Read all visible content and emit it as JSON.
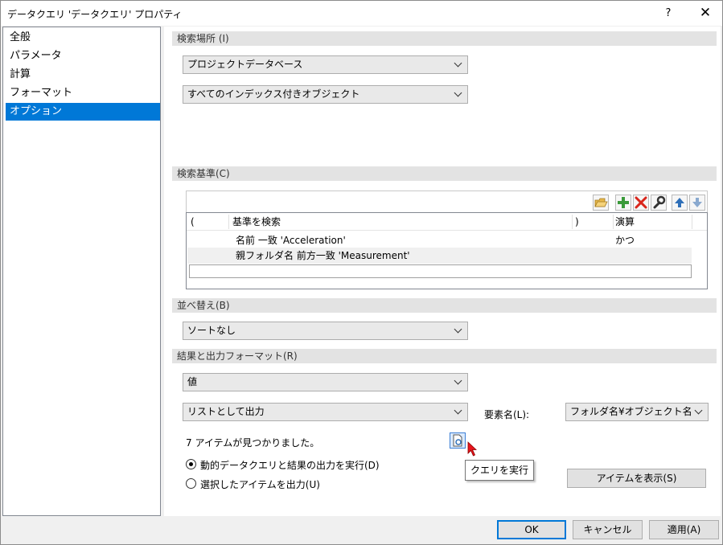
{
  "window": {
    "title": "データクエリ 'データクエリ' プロパティ",
    "help": "?",
    "close": "✕"
  },
  "nav": {
    "items": [
      "全般",
      "パラメータ",
      "計算",
      "フォーマット",
      "オプション"
    ],
    "selected_index": 4
  },
  "search_location": {
    "header": "検索場所 (I)",
    "database": "プロジェクトデータベース",
    "objects": "すべてのインデックス付きオブジェクト"
  },
  "search_criteria": {
    "header": "検索基準(C)",
    "columns": [
      "(",
      "基準を検索",
      ")",
      "演算"
    ],
    "rows": [
      {
        "open": "",
        "criterion": "名前 一致 'Acceleration'",
        "close": "",
        "operator": "かつ"
      },
      {
        "open": "",
        "criterion": "親フォルダ名 前方一致 'Measurement'",
        "close": "",
        "operator": ""
      }
    ],
    "toolbar_icons": [
      "open-folder-icon",
      "add-icon",
      "delete-icon",
      "wrench-icon",
      "arrow-up-icon",
      "arrow-down-icon"
    ]
  },
  "sort": {
    "header": "並べ替え(B)",
    "value": "ソートなし"
  },
  "results": {
    "header": "結果と出力フォーマット(R)",
    "value_format": "値",
    "output_mode": "リストとして出力",
    "element_name_label": "要素名(L):",
    "element_name_value": "フォルダ名¥オブジェクト名",
    "found_text": "7 アイテムが見つかりました。",
    "query_tooltip": "クエリを実行",
    "radio_dynamic": "動的データクエリと結果の出力を実行(D)",
    "radio_selected": "選択したアイテムを出力(U)",
    "show_items_button": "アイテムを表示(S)"
  },
  "footer": {
    "ok": "OK",
    "cancel": "キャンセル",
    "apply": "適用(A)"
  },
  "colors": {
    "accent": "#0078d7",
    "add_green": "#3a9a3a",
    "delete_red": "#d9261c",
    "cursor_red": "#e8141c"
  }
}
